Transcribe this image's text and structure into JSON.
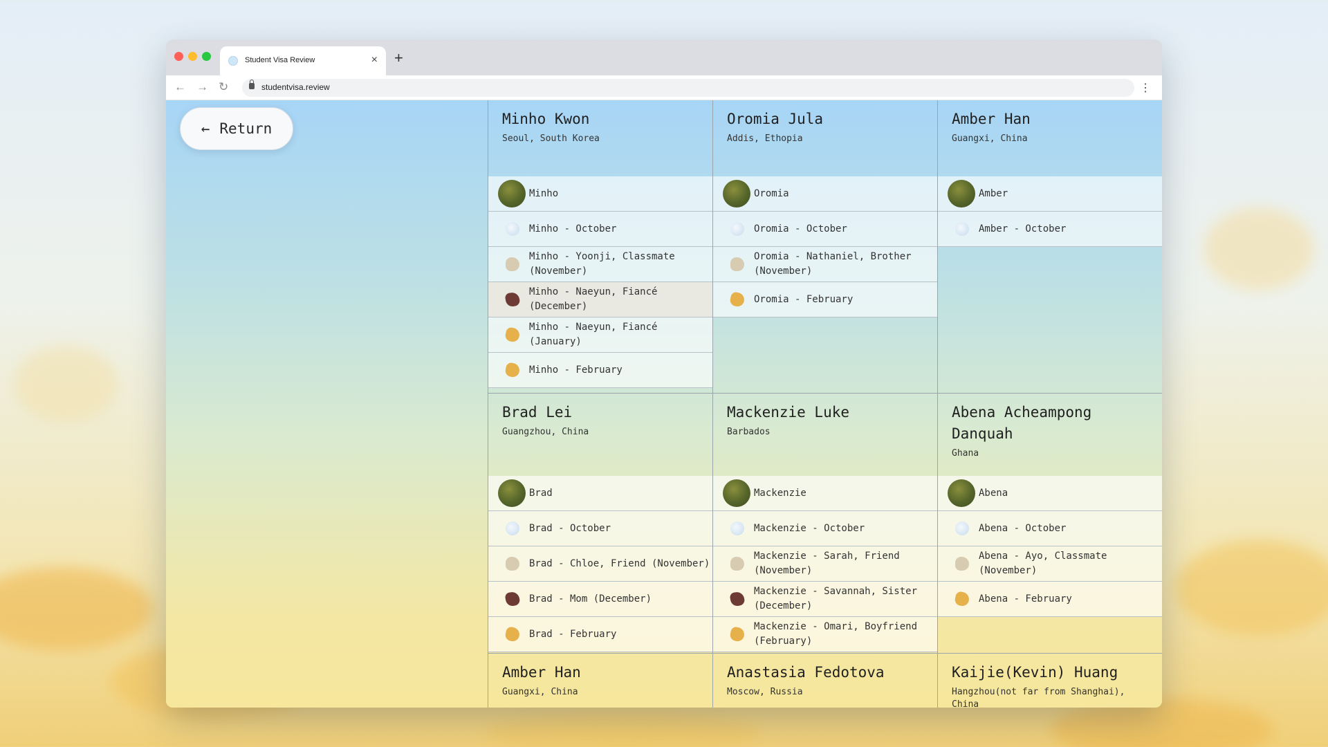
{
  "browser": {
    "tab_title": "Student Visa Review",
    "tab_close": "×",
    "new_tab": "+",
    "url": "studentvisa.review",
    "nav": {
      "back": "←",
      "forward": "→",
      "reload": "↻",
      "menu": "⋮"
    }
  },
  "return_button": {
    "arrow": "←",
    "label": "Return"
  },
  "students": [
    {
      "name": "Minho Kwon",
      "location": "Seoul, South Korea",
      "entries": [
        {
          "icon": "moss-stone-icon",
          "label": "Minho"
        },
        {
          "icon": "cloud-stone-icon",
          "label": "Minho - October"
        },
        {
          "icon": "sand-stone-icon",
          "label": "Minho - Yoonji, Classmate (November)"
        },
        {
          "icon": "dark-stone-icon",
          "label": "Minho - Naeyun, Fiancé (December)"
        },
        {
          "icon": "amber-stone-icon",
          "label": "Minho - Naeyun, Fiancé (January)"
        },
        {
          "icon": "amber-stone-icon",
          "label": "Minho - February"
        }
      ]
    },
    {
      "name": "Oromia Jula",
      "location": "Addis, Ethopia",
      "entries": [
        {
          "icon": "moss-stone-icon",
          "label": "Oromia"
        },
        {
          "icon": "cloud-stone-icon",
          "label": "Oromia - October"
        },
        {
          "icon": "sand-stone-icon",
          "label": "Oromia - Nathaniel, Brother (November)"
        },
        {
          "icon": "amber-stone-icon",
          "label": "Oromia - February"
        }
      ]
    },
    {
      "name": "Amber Han",
      "location": "Guangxi, China",
      "entries": [
        {
          "icon": "moss-stone-icon",
          "label": "Amber"
        },
        {
          "icon": "cloud-stone-icon",
          "label": "Amber - October"
        }
      ]
    },
    {
      "name": "Brad Lei",
      "location": "Guangzhou, China",
      "entries": [
        {
          "icon": "moss-stone-icon",
          "label": "Brad"
        },
        {
          "icon": "cloud-stone-icon",
          "label": "Brad - October"
        },
        {
          "icon": "sand-stone-icon",
          "label": "Brad - Chloe, Friend (November)"
        },
        {
          "icon": "dark-stone-icon",
          "label": "Brad - Mom (December)"
        },
        {
          "icon": "amber-stone-icon",
          "label": "Brad - February"
        }
      ]
    },
    {
      "name": "Mackenzie Luke",
      "location": "Barbados",
      "entries": [
        {
          "icon": "moss-stone-icon",
          "label": "Mackenzie"
        },
        {
          "icon": "cloud-stone-icon",
          "label": "Mackenzie - October"
        },
        {
          "icon": "sand-stone-icon",
          "label": "Mackenzie - Sarah, Friend (November)"
        },
        {
          "icon": "dark-stone-icon",
          "label": "Mackenzie - Savannah, Sister (December)"
        },
        {
          "icon": "amber-stone-icon",
          "label": "Mackenzie - Omari, Boyfriend (February)"
        }
      ]
    },
    {
      "name": "Abena Acheampong Danquah",
      "location": "Ghana",
      "entries": [
        {
          "icon": "moss-stone-icon",
          "label": "Abena"
        },
        {
          "icon": "cloud-stone-icon",
          "label": "Abena - October"
        },
        {
          "icon": "sand-stone-icon",
          "label": "Abena - Ayo, Classmate (November)"
        },
        {
          "icon": "amber-stone-icon",
          "label": "Abena - February"
        }
      ]
    },
    {
      "name": "Amber Han",
      "location": "Guangxi, China",
      "entries": []
    },
    {
      "name": "Anastasia Fedotova",
      "location": "Moscow, Russia",
      "entries": []
    },
    {
      "name": "Kaijie(Kevin) Huang",
      "location": "Hangzhou(not far from Shanghai), China",
      "entries": []
    }
  ]
}
